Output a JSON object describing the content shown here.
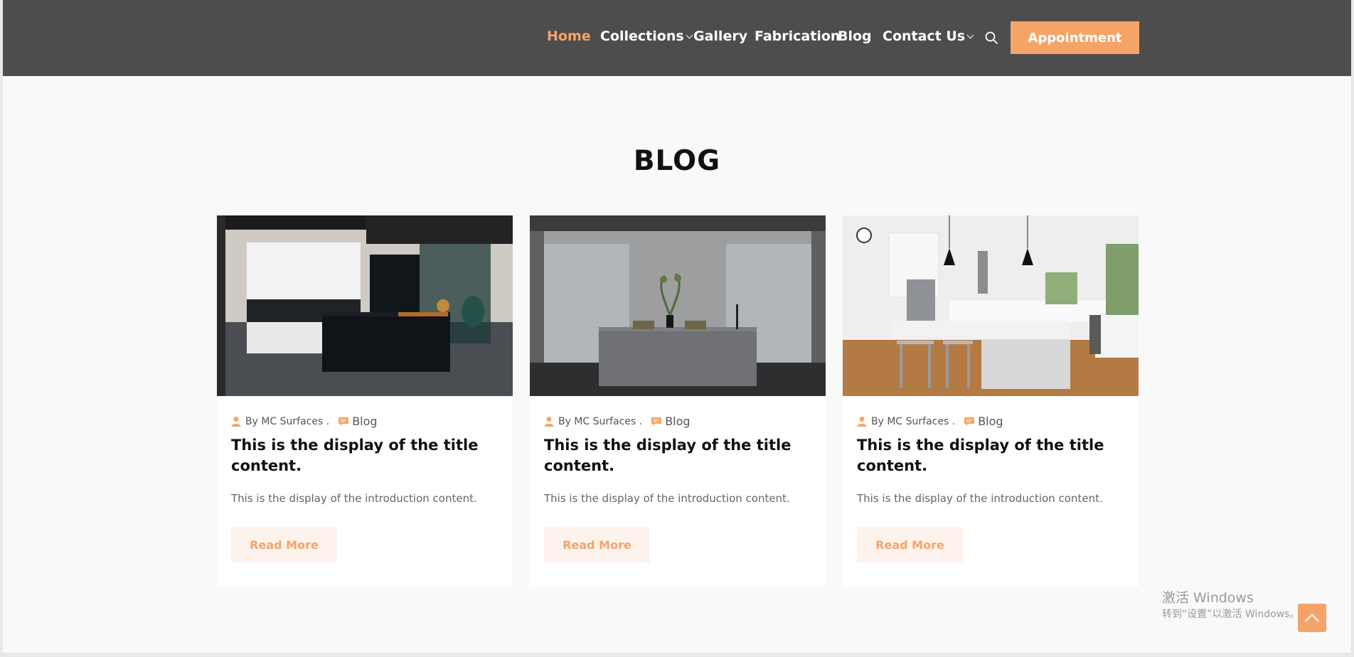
{
  "nav": {
    "items": [
      {
        "label": "Home",
        "active": true,
        "dropdown": false
      },
      {
        "label": "Collections",
        "active": false,
        "dropdown": true
      },
      {
        "label": "Gallery",
        "active": false,
        "dropdown": false
      },
      {
        "label": "Fabrication",
        "active": false,
        "dropdown": false
      },
      {
        "label": "Blog",
        "active": false,
        "dropdown": false
      },
      {
        "label": "Contact Us",
        "active": false,
        "dropdown": true
      }
    ],
    "search_icon": "search-icon",
    "appointment_label": "Appointment"
  },
  "section": {
    "title": "BLOG"
  },
  "posts": [
    {
      "author": "By MC Surfaces .",
      "category": "Blog",
      "title": "This is the display of the title content.",
      "intro": "This is the display of the introduction content.",
      "read_more": "Read More"
    },
    {
      "author": "By MC Surfaces .",
      "category": "Blog",
      "title": "This is the display of the title content.",
      "intro": "This is the display of the introduction content.",
      "read_more": "Read More"
    },
    {
      "author": "By MC Surfaces .",
      "category": "Blog",
      "title": "This is the display of the title content.",
      "intro": "This is the display of the introduction content.",
      "read_more": "Read More"
    }
  ],
  "watermark": {
    "line1": "激活 Windows",
    "line2": "转到“设置”以激活 Windows。"
  },
  "colors": {
    "accent": "#f5a469",
    "header_bg": "#4d4d4d",
    "page_bg": "#f9f9f9",
    "read_more_bg": "#fdf3ec"
  }
}
